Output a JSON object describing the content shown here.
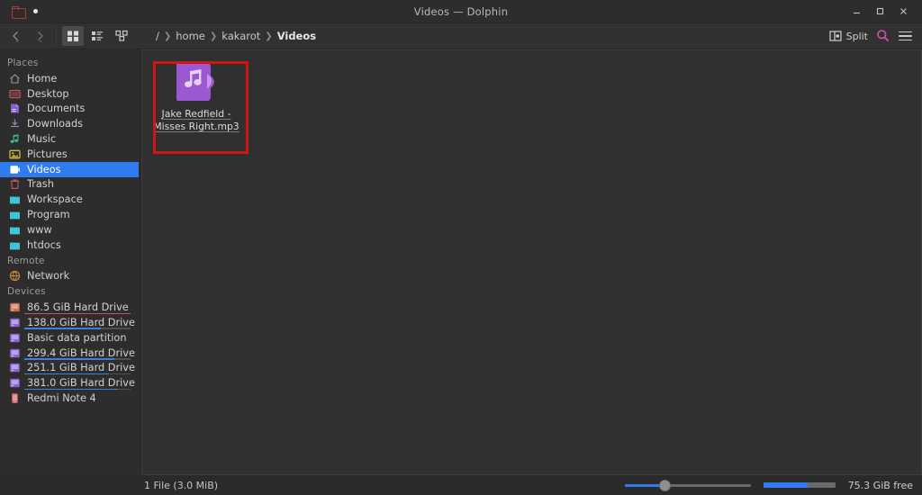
{
  "window": {
    "title": "Videos — Dolphin",
    "app_icon": "folder-icon",
    "minimize_label": "—",
    "maximize_label": "□",
    "close_label": "✕"
  },
  "toolbar": {
    "back_label": "Back",
    "forward_label": "Forward",
    "view_icons_label": "Icons",
    "view_details_label": "Details",
    "view_compact_label": "Compact",
    "split_label": "Split",
    "search_label": "Search",
    "menu_label": "Menu",
    "breadcrumb": [
      {
        "label": "/",
        "current": false
      },
      {
        "label": "home",
        "current": false
      },
      {
        "label": "kakarot",
        "current": false
      },
      {
        "label": "Videos",
        "current": true
      }
    ]
  },
  "sidebar": {
    "sections": [
      {
        "title": "Places",
        "items": [
          {
            "label": "Home",
            "icon": "home-icon",
            "color": "#9a9a9a",
            "selected": false
          },
          {
            "label": "Desktop",
            "icon": "desktop-icon",
            "color": "#c8545c",
            "selected": false
          },
          {
            "label": "Documents",
            "icon": "documents-icon",
            "color": "#8a5fd6",
            "selected": false
          },
          {
            "label": "Downloads",
            "icon": "downloads-icon",
            "color": "#7f8fb3",
            "selected": false
          },
          {
            "label": "Music",
            "icon": "music-icon",
            "color": "#3fbf7f",
            "selected": false
          },
          {
            "label": "Pictures",
            "icon": "pictures-icon",
            "color": "#d2b53c",
            "selected": false
          },
          {
            "label": "Videos",
            "icon": "videos-icon",
            "color": "#ffffff",
            "selected": true
          },
          {
            "label": "Trash",
            "icon": "trash-icon",
            "color": "#c0525c",
            "selected": false
          },
          {
            "label": "Workspace",
            "icon": "folder-icon",
            "color": "#3fc6d6",
            "selected": false
          },
          {
            "label": "Program",
            "icon": "folder-icon",
            "color": "#3fc6d6",
            "selected": false
          },
          {
            "label": "www",
            "icon": "folder-icon",
            "color": "#3fc6d6",
            "selected": false
          },
          {
            "label": "htdocs",
            "icon": "folder-icon",
            "color": "#3fc6d6",
            "selected": false
          }
        ]
      },
      {
        "title": "Remote",
        "items": [
          {
            "label": "Network",
            "icon": "network-icon",
            "color": "#c98a3c",
            "selected": false
          }
        ]
      },
      {
        "title": "Devices",
        "items": [
          {
            "label": "86.5 GiB Hard Drive",
            "icon": "hdd-icon",
            "color": "#d2683c",
            "selected": false,
            "capacity_pct": 100,
            "capacity_color": "#d44a5a"
          },
          {
            "label": "138.0 GiB Hard Drive",
            "icon": "hdd-icon",
            "color": "#8a5fd6",
            "selected": false,
            "capacity_pct": 72,
            "capacity_color": "#3d7fdf"
          },
          {
            "label": "Basic data partition",
            "icon": "hdd-icon",
            "color": "#8a5fd6",
            "selected": false,
            "capacity_pct": 0,
            "capacity_color": "#3d7fdf"
          },
          {
            "label": "299.4 GiB Hard Drive",
            "icon": "hdd-icon",
            "color": "#8a5fd6",
            "selected": false,
            "capacity_pct": 85,
            "capacity_color": "#3d7fdf"
          },
          {
            "label": "251.1 GiB Hard Drive",
            "icon": "hdd-icon",
            "color": "#8a5fd6",
            "selected": false,
            "capacity_pct": 80,
            "capacity_color": "#3d7fdf"
          },
          {
            "label": "381.0 GiB Hard Drive",
            "icon": "hdd-icon",
            "color": "#8a5fd6",
            "selected": false,
            "capacity_pct": 88,
            "capacity_color": "#3d7fdf"
          },
          {
            "label": "Redmi Note 4",
            "icon": "phone-icon",
            "color": "#c0525c",
            "selected": false,
            "capacity_pct": 0,
            "capacity_color": "#3d7fdf"
          }
        ]
      }
    ]
  },
  "main": {
    "files": [
      {
        "name_line1": "Jake Redfield -",
        "name_line2": "Misses Right.mp3",
        "icon": "audio-file-icon",
        "icon_color": "#9b58d0",
        "highlighted": true
      }
    ],
    "highlight_color": "#d01515"
  },
  "statusbar": {
    "selection_text": "1 File (3.0 MiB)",
    "zoom_value": 32,
    "free_space_text": "75.3 GiB free",
    "free_space_pct": 62,
    "accent_color": "#2f7bef"
  }
}
